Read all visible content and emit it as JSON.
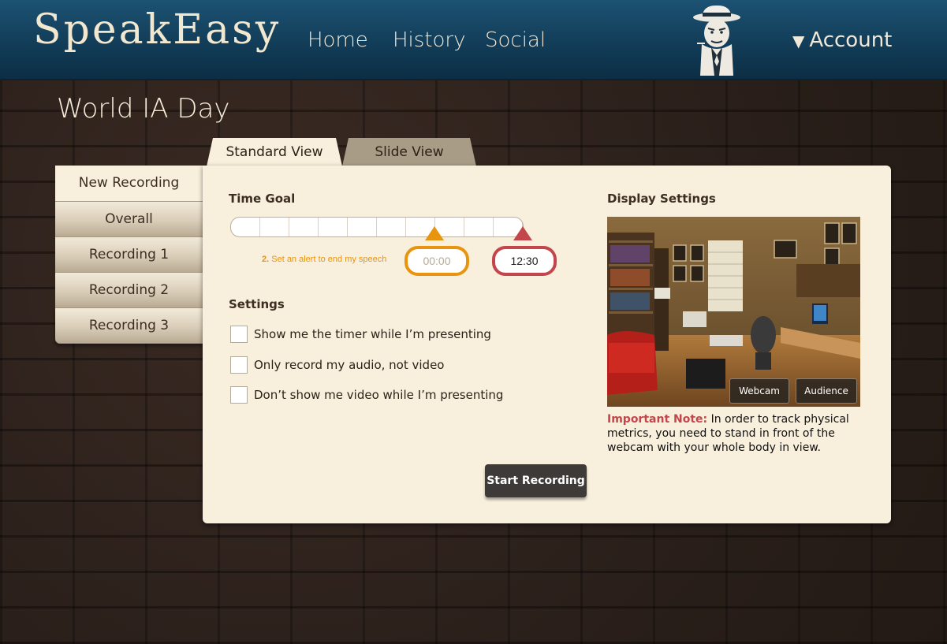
{
  "brand": {
    "name": "SpeakEasy"
  },
  "nav": {
    "home": "Home",
    "history": "History",
    "social": "Social",
    "account": "Account",
    "account_arrow": "▼"
  },
  "page": {
    "title": "World IA Day"
  },
  "sidebar": {
    "items": [
      {
        "label": "New Recording",
        "active": true
      },
      {
        "label": "Overall"
      },
      {
        "label": "Recording 1"
      },
      {
        "label": "Recording 2"
      },
      {
        "label": "Recording 3"
      }
    ]
  },
  "tabs": [
    {
      "label": "Standard View",
      "active": true
    },
    {
      "label": "Slide View"
    }
  ],
  "time_goal": {
    "title": "Time Goal",
    "hint_step": "2.",
    "hint_text": "Set an alert to end my speech",
    "alert_value": "00:00",
    "end_value": "12:30"
  },
  "settings": {
    "title": "Settings",
    "options": [
      {
        "label": "Show me the timer while I’m presenting",
        "checked": false
      },
      {
        "label": "Only record my audio, not video",
        "checked": false
      },
      {
        "label": "Don’t show me video while I’m presenting",
        "checked": false
      }
    ]
  },
  "display": {
    "title": "Display Settings",
    "webcam_label": "Webcam",
    "audience_label": "Audience",
    "note_label": "Important Note:",
    "note_text": " In order to track physical metrics, you need to stand in front of the webcam with your whole body in view."
  },
  "actions": {
    "start_recording": "Start Recording"
  },
  "colors": {
    "accent_orange": "#e8940f",
    "accent_red": "#c2464b",
    "header_blue": "#123d58",
    "panel_bg": "#f8efdc"
  },
  "icons": {
    "mascot": "gangster-mascot-icon",
    "account_arrow": "triangle-down-icon"
  }
}
